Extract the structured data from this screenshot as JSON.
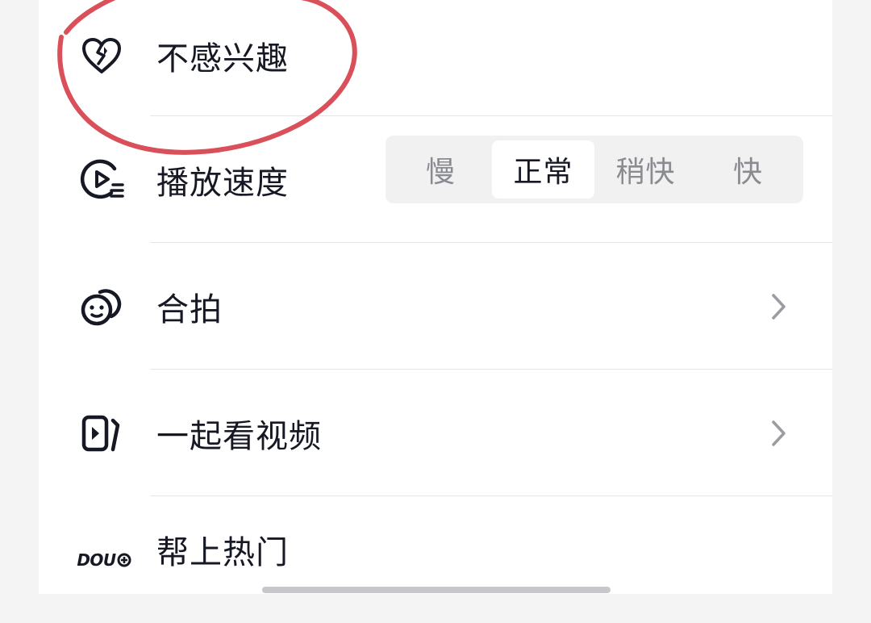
{
  "menu": {
    "not_interested": {
      "label": "不感兴趣",
      "icon": "broken-heart-icon"
    },
    "playback_speed": {
      "label": "播放速度",
      "icon": "play-speed-icon",
      "options": [
        "慢",
        "正常",
        "稍快",
        "快"
      ],
      "selected": "正常"
    },
    "duet": {
      "label": "合拍",
      "icon": "duet-icon"
    },
    "watch_together": {
      "label": "一起看视频",
      "icon": "watch-together-icon"
    },
    "promote": {
      "label": "帮上热门",
      "icon": "dou-plus-icon",
      "logo_text": "DOU"
    }
  },
  "annotation": {
    "color": "#d9505a"
  },
  "colors": {
    "text": "#161823",
    "muted": "#8a8b91",
    "divider": "#e6e6e8",
    "segment_bg": "#f1f1f2"
  }
}
